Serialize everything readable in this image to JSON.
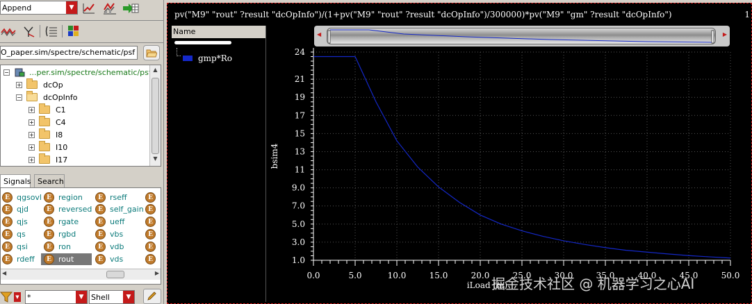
{
  "toolbar": {
    "append_label": "Append",
    "icons": [
      "line-chart-icon",
      "multi-chart-icon",
      "export-table-icon",
      "waveform-icon",
      "y-axis-icon",
      "list-icon",
      "grid-palette-icon"
    ]
  },
  "path": {
    "value": "O_paper.sim/spectre/schematic/psf"
  },
  "tree": {
    "root_label": "...per.sim/spectre/schematic/psf",
    "items": [
      {
        "label": "dcOp"
      },
      {
        "label": "dcOpInfo"
      },
      {
        "label": "C1"
      },
      {
        "label": "C4"
      },
      {
        "label": "I8"
      },
      {
        "label": "I10"
      },
      {
        "label": "I17"
      }
    ]
  },
  "tabs": {
    "signals": "Signals",
    "search": "Search"
  },
  "signals": {
    "col1": [
      "qgsovl",
      "qjd",
      "qjs",
      "qs",
      "qsi",
      "rdeff"
    ],
    "col2": [
      "region",
      "reversed",
      "rgate",
      "rgbd",
      "ron",
      "rout"
    ],
    "col3": [
      "rseff",
      "self_gain",
      "ueff",
      "vbs",
      "vdb",
      "vds"
    ],
    "selected": "rout"
  },
  "bottom": {
    "filter_value": "*",
    "shell_label": "Shell"
  },
  "graph": {
    "expression": "pv(\"M9\" \"rout\" ?result \"dcOpInfo\")/(1+pv(\"M9\" \"rout\" ?result \"dcOpInfo\")/300000)*pv(\"M9\" \"gm\" ?result \"dcOpInfo\")",
    "corner_label": "1",
    "name_header": "Name",
    "watermark": "掘金技术社区 @ 机器学习之心AI"
  },
  "chart_data": {
    "type": "line",
    "xlabel": "iLoad (m)",
    "ylabel": "bsim4",
    "xlim": [
      0,
      50
    ],
    "ylim": [
      1.0,
      24
    ],
    "xticks": [
      "0.0",
      "5.0",
      "10.0",
      "15.0",
      "20.0",
      "25.0",
      "30.0",
      "35.0",
      "40.0",
      "45.0",
      "50.0"
    ],
    "yticks": [
      "1.0",
      "3.0",
      "5.0",
      "7.0",
      "9.0",
      "11",
      "13",
      "15",
      "17",
      "19",
      "21",
      "24"
    ],
    "grid": true,
    "series": [
      {
        "name": "gmp*Ro",
        "color": "#1428c8",
        "x": [
          0,
          5,
          7.5,
          10,
          12.5,
          15,
          17.5,
          20,
          22.5,
          25,
          27.5,
          30,
          32.5,
          35,
          37.5,
          40,
          42.5,
          45,
          47.5,
          50
        ],
        "y": [
          23.5,
          23.5,
          18.5,
          14.2,
          11.3,
          9.1,
          7.4,
          6.0,
          5.0,
          4.25,
          3.65,
          3.15,
          2.75,
          2.4,
          2.1,
          1.9,
          1.7,
          1.52,
          1.38,
          1.25
        ]
      }
    ]
  }
}
